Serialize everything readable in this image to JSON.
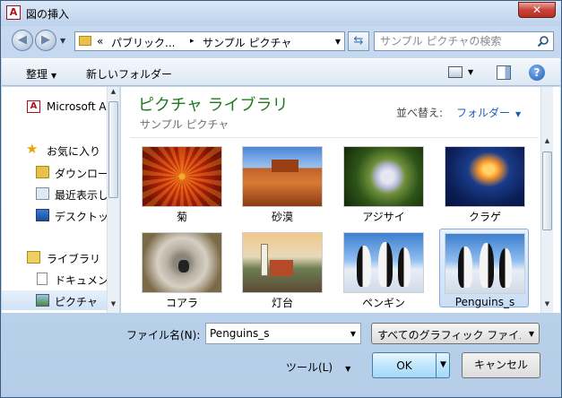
{
  "window": {
    "title": "図の挿入",
    "app_icon": "access-icon",
    "close_label": "✕"
  },
  "address": {
    "overflow": "«",
    "segments": [
      "パブリック...",
      "サンプル ピクチャ"
    ],
    "separator": "▸"
  },
  "search": {
    "placeholder": "サンプル ピクチャの検索"
  },
  "toolbar": {
    "organize": "整理",
    "new_folder": "新しいフォルダー"
  },
  "nav": {
    "items": [
      {
        "label": "Microsoft A",
        "icon": "access-icon"
      },
      {
        "label": "お気に入り",
        "icon": "star-icon"
      },
      {
        "label": "ダウンロー",
        "icon": "download-folder-icon"
      },
      {
        "label": "最近表示し",
        "icon": "recent-places-icon"
      },
      {
        "label": "デスクトッ",
        "icon": "desktop-icon"
      },
      {
        "label": "ライブラリ",
        "icon": "library-icon"
      },
      {
        "label": "ドキュメン",
        "icon": "documents-icon"
      },
      {
        "label": "ピクチャ",
        "icon": "pictures-icon"
      }
    ]
  },
  "library": {
    "title": "ピクチャ ライブラリ",
    "subtitle": "サンプル ピクチャ",
    "sort_label": "並べ替え:",
    "sort_value": "フォルダー"
  },
  "thumbnails": [
    {
      "label": "菊",
      "image": "chrysanthemum"
    },
    {
      "label": "砂漠",
      "image": "desert"
    },
    {
      "label": "アジサイ",
      "image": "hydrangeas"
    },
    {
      "label": "クラゲ",
      "image": "jellyfish"
    },
    {
      "label": "コアラ",
      "image": "koala"
    },
    {
      "label": "灯台",
      "image": "lighthouse"
    },
    {
      "label": "ペンギン",
      "image": "penguins"
    },
    {
      "label": "Penguins_s",
      "image": "penguins",
      "selected": true
    }
  ],
  "file_name": {
    "label": "ファイル名(N):",
    "value": "Penguins_s"
  },
  "file_type": {
    "value": "すべてのグラフィック ファイル"
  },
  "tools": {
    "label": "ツール(L)"
  },
  "buttons": {
    "ok": "OK",
    "cancel": "キャンセル"
  },
  "colors": {
    "library_title": "#1e7b1e",
    "link": "#1d5fb8",
    "selection": "#cfe2f7"
  }
}
